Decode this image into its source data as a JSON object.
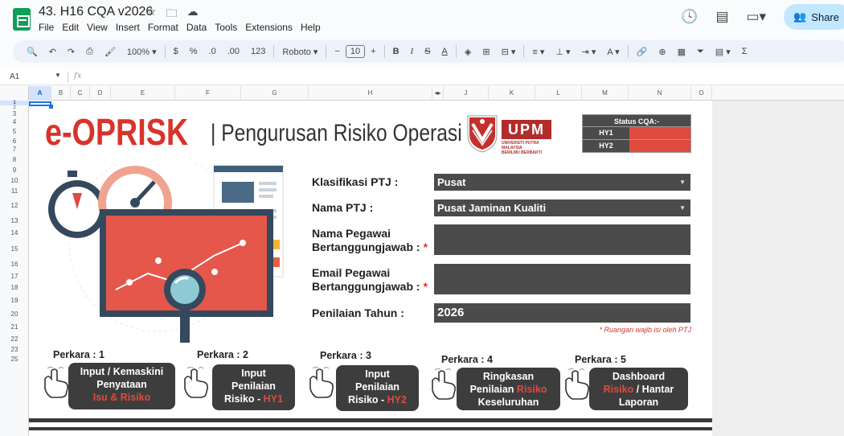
{
  "doc": {
    "title": "43. H16 CQA v2026"
  },
  "menu": [
    "File",
    "Edit",
    "View",
    "Insert",
    "Format",
    "Data",
    "Tools",
    "Extensions",
    "Help"
  ],
  "share_label": "Share",
  "toolbar": {
    "zoom": "100%",
    "currency": "$",
    "percent": "%",
    "dec_decrease": ".0",
    "dec_increase": ".00",
    "number_format": "123",
    "font": "Roboto",
    "font_size": "10",
    "bold": "B",
    "italic": "I",
    "strike": "S",
    "text_color": "A",
    "sigma": "Σ"
  },
  "formula_bar": {
    "cell_ref": "A1",
    "fx": "fx"
  },
  "columns": [
    "A",
    "B",
    "C",
    "D",
    "E",
    "F",
    "G",
    "H",
    "J",
    "K",
    "L",
    "M",
    "N",
    "O"
  ],
  "rows": [
    "1",
    "2",
    "3",
    "4",
    "5",
    "6",
    "7",
    "8",
    "9",
    "10",
    "11",
    "12",
    "13",
    "14",
    "15",
    "16",
    "17",
    "18",
    "19",
    "20",
    "21",
    "22",
    "23",
    "25"
  ],
  "banner": {
    "brand": "e-OPRISK",
    "subtitle": "| Pengurusan Risiko Operasi",
    "upm": "UPM",
    "upm_small": "UNIVERSITI PUTRA MALAYSIA",
    "upm_motto": "BERILMU BERBAKTI"
  },
  "status": {
    "heading": "Status CQA:-",
    "rows": [
      {
        "label": "HY1",
        "value": ""
      },
      {
        "label": "HY2",
        "value": ""
      }
    ]
  },
  "form": {
    "klasifikasi_label": "Klasifikasi PTJ :",
    "klasifikasi_value": "Pusat",
    "nama_ptj_label": "Nama PTJ :",
    "nama_ptj_value": "Pusat Jaminan Kualiti",
    "pegawai_label_1": "Nama Pegawai",
    "pegawai_label_2": "Bertanggungjawab :",
    "pegawai_value": "",
    "email_label_1": "Email Pegawai",
    "email_label_2": "Bertanggungjawab :",
    "email_value": "",
    "tahun_label": "Penilaian Tahun :",
    "tahun_value": "2026",
    "required_mark": "*",
    "note": "* Ruangan wajib isi oleh PTJ"
  },
  "perkara": [
    {
      "title": "Perkara : 1",
      "line1": "Input / Kemaskini",
      "line2": "Penyataan",
      "line3_red": "Isu & Risiko",
      "line3_rest": ""
    },
    {
      "title": "Perkara : 2",
      "line1": "Input",
      "line2": "Penilaian",
      "line3_pre": "Risiko - ",
      "line3_red": "HY1"
    },
    {
      "title": "Perkara : 3",
      "line1": "Input",
      "line2": "Penilaian",
      "line3_pre": "Risiko - ",
      "line3_red": "HY2"
    },
    {
      "title": "Perkara : 4",
      "line1": "Ringkasan",
      "line2_pre": "Penilaian ",
      "line2_red": "Risiko",
      "line3": "Keseluruhan"
    },
    {
      "title": "Perkara : 5",
      "line1": "Dashboard",
      "line2_red": "Risiko",
      "line2_post": " /  Hantar",
      "line3": "Laporan"
    }
  ],
  "colors": {
    "brand_red": "#d8342b",
    "field_gray": "#4b4b4b",
    "button_dark": "#3d3d3d",
    "share_bg": "#c2e7ff"
  }
}
